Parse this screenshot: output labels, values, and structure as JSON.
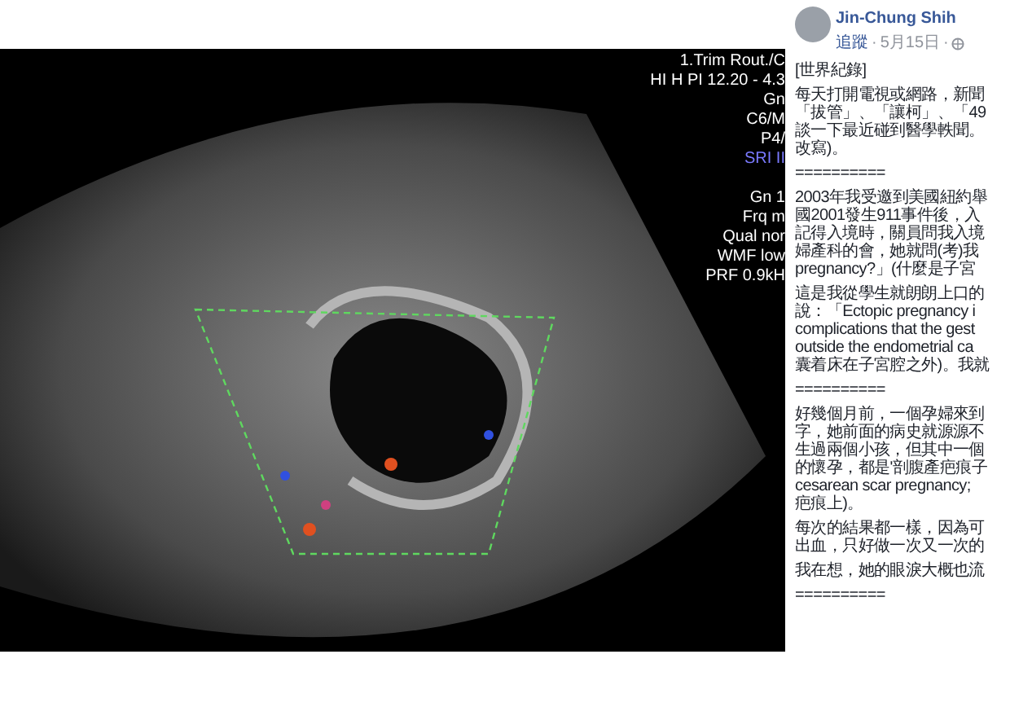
{
  "ultrasound": {
    "settings": [
      {
        "text": "1.Trim Rout./C",
        "highlight": false
      },
      {
        "text": "HI H PI 12.20 - 4.3",
        "highlight": false
      },
      {
        "text": "Gn",
        "highlight": false
      },
      {
        "text": "C6/M",
        "highlight": false
      },
      {
        "text": "P4/",
        "highlight": false
      },
      {
        "text": "SRI II",
        "highlight": true
      },
      {
        "text": "Gn 1",
        "highlight": false,
        "gap": true
      },
      {
        "text": "Frq m",
        "highlight": false
      },
      {
        "text": "Qual nor",
        "highlight": false
      },
      {
        "text": "WMF low",
        "highlight": false
      },
      {
        "text": "PRF 0.9kH",
        "highlight": false
      }
    ]
  },
  "post": {
    "author": "Jin-Chung Shih",
    "follow": "追蹤",
    "separator": "·",
    "date": "5月15日",
    "paragraphs": [
      [
        "[世界紀錄]"
      ],
      [
        "每天打開電視或網路，新聞",
        "「拔管」、「讓柯」、「49",
        "談一下最近碰到醫學軼聞。",
        "改寫)。"
      ],
      [
        "=========="
      ],
      [
        "2003年我受邀到美國紐約舉",
        "國2001發生911事件後，入",
        "記得入境時，關員問我入境",
        "婦產科的會，她就問(考)我",
        "pregnancy?」(什麼是子宮"
      ],
      [
        "這是我從學生就朗朗上口的",
        "說：「Ectopic pregnancy i",
        "complications that the gest",
        "outside the endometrial ca",
        "囊着床在子宮腔之外)。我就"
      ],
      [
        "=========="
      ],
      [
        "好幾個月前，一個孕婦來到",
        "字，她前面的病史就源源不",
        "生過兩個小孩，但其中一個",
        "的懷孕，都是'剖腹產疤痕子",
        "cesarean scar pregnancy;",
        "疤痕上)。"
      ],
      [
        "每次的結果都一樣，因為可",
        "出血，只好做一次又一次的"
      ],
      [
        "我在想，她的眼淚大概也流"
      ],
      [
        "=========="
      ]
    ]
  }
}
